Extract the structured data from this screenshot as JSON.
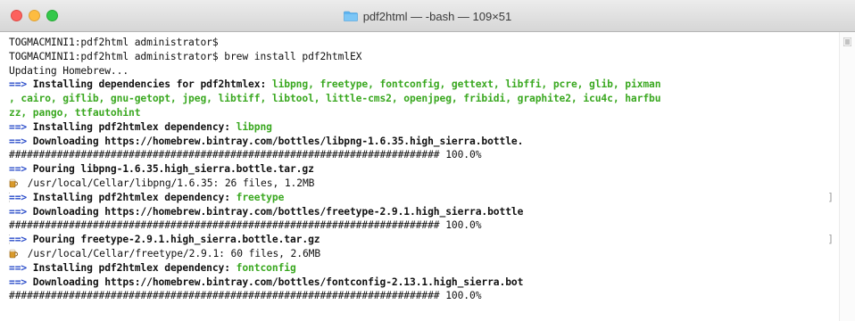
{
  "window": {
    "title": "pdf2html — -bash — 109×51",
    "folder_icon": "folder-icon"
  },
  "colors": {
    "arrow": "#2a4cc9",
    "package": "#3aa820",
    "text": "#111111"
  },
  "lines": [
    {
      "type": "plain",
      "text": "TOGMACMINI1:pdf2html administrator$"
    },
    {
      "type": "plain",
      "text": "TOGMACMINI1:pdf2html administrator$ brew install pdf2htmlEX"
    },
    {
      "type": "plain",
      "text": "Updating Homebrew..."
    },
    {
      "type": "arrow",
      "arrow": "==>",
      "text": " Installing dependencies for pdf2htmlex: ",
      "green": "libpng, freetype, fontconfig, gettext, libffi, pcre, glib, pixman"
    },
    {
      "type": "green",
      "text": ", cairo, giflib, gnu-getopt, jpeg, libtiff, libtool, little-cms2, openjpeg, fribidi, graphite2, icu4c, harfbu"
    },
    {
      "type": "green",
      "text": "zz, pango, ttfautohint"
    },
    {
      "type": "arrow",
      "arrow": "==>",
      "text": " Installing pdf2htmlex dependency: ",
      "green": "libpng"
    },
    {
      "type": "arrow",
      "arrow": "==>",
      "text": " Downloading https://homebrew.bintray.com/bottles/libpng-1.6.35.high_sierra.bottle.",
      "green": ""
    },
    {
      "type": "plain",
      "text": "######################################################################## 100.0%"
    },
    {
      "type": "arrow",
      "arrow": "==>",
      "text": " Pouring libpng-1.6.35.high_sierra.bottle.tar.gz",
      "green": ""
    },
    {
      "type": "beer",
      "icon": "beer-mug-icon",
      "text": " /usr/local/Cellar/libpng/1.6.35: 26 files, 1.2MB"
    },
    {
      "type": "arrow",
      "arrow": "==>",
      "text": " Installing pdf2htmlex dependency: ",
      "green": "freetype",
      "brackets": true
    },
    {
      "type": "arrow",
      "arrow": "==>",
      "text": " Downloading https://homebrew.bintray.com/bottles/freetype-2.9.1.high_sierra.bottle",
      "green": ""
    },
    {
      "type": "plain",
      "text": "######################################################################## 100.0%"
    },
    {
      "type": "arrow",
      "arrow": "==>",
      "text": " Pouring freetype-2.9.1.high_sierra.bottle.tar.gz",
      "green": "",
      "brackets": true
    },
    {
      "type": "beer",
      "icon": "beer-mug-icon",
      "text": " /usr/local/Cellar/freetype/2.9.1: 60 files, 2.6MB"
    },
    {
      "type": "arrow",
      "arrow": "==>",
      "text": " Installing pdf2htmlex dependency: ",
      "green": "fontconfig"
    },
    {
      "type": "arrow",
      "arrow": "==>",
      "text": " Downloading https://homebrew.bintray.com/bottles/fontconfig-2.13.1.high_sierra.bot",
      "green": ""
    },
    {
      "type": "plain",
      "text": "######################################################################## 100.0%"
    }
  ]
}
